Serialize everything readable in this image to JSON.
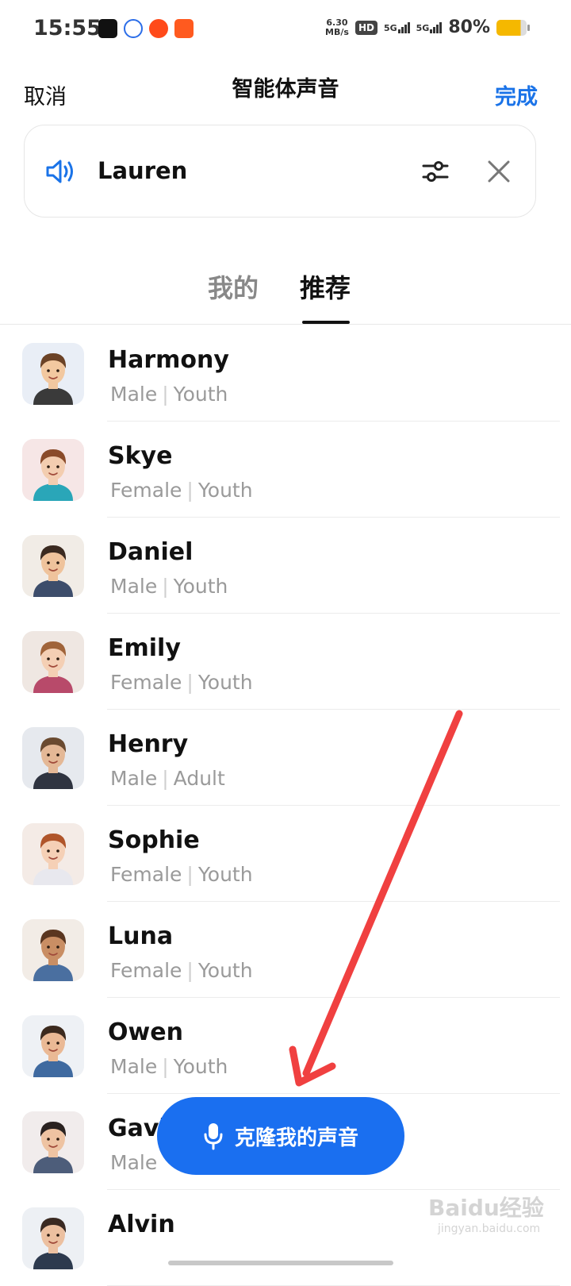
{
  "status_bar": {
    "time": "15:55",
    "net_speed_value": "6.30",
    "net_speed_unit": "MB/s",
    "hd_label": "HD",
    "sim1_label": "5G",
    "sim2_label": "5G",
    "battery_percent": "80%",
    "battery_color": "#f5b800",
    "app_icons": [
      "tiktok-icon",
      "baidu-paw-icon",
      "taobao-icon",
      "xiaohongshu-icon"
    ]
  },
  "header": {
    "cancel_label": "取消",
    "title": "智能体声音",
    "done_label": "完成",
    "accent_color": "#1a73e8"
  },
  "selected_voice": {
    "name": "Lauren",
    "icons": [
      "speaker-icon",
      "settings-sliders-icon",
      "close-icon"
    ]
  },
  "tabs": {
    "mine_label": "我的",
    "recommended_label": "推荐",
    "active": "推荐"
  },
  "voices": [
    {
      "name": "Harmony",
      "gender": "Male",
      "age": "Youth",
      "avatar": "avatar-harmony"
    },
    {
      "name": "Skye",
      "gender": "Female",
      "age": "Youth",
      "avatar": "avatar-skye"
    },
    {
      "name": "Daniel",
      "gender": "Male",
      "age": "Youth",
      "avatar": "avatar-daniel"
    },
    {
      "name": "Emily",
      "gender": "Female",
      "age": "Youth",
      "avatar": "avatar-emily"
    },
    {
      "name": "Henry",
      "gender": "Male",
      "age": "Adult",
      "avatar": "avatar-henry"
    },
    {
      "name": "Sophie",
      "gender": "Female",
      "age": "Youth",
      "avatar": "avatar-sophie"
    },
    {
      "name": "Luna",
      "gender": "Female",
      "age": "Youth",
      "avatar": "avatar-luna"
    },
    {
      "name": "Owen",
      "gender": "Male",
      "age": "Youth",
      "avatar": "avatar-owen"
    },
    {
      "name": "Gavi",
      "gender": "Male",
      "age": "",
      "avatar": "avatar-gavin"
    },
    {
      "name": "Alvin",
      "gender": "",
      "age": "",
      "avatar": "avatar-alvin"
    }
  ],
  "tag_separator": "|",
  "clone_button": {
    "label": "克隆我的声音",
    "icon": "microphone-icon",
    "color": "#1a6ff0"
  },
  "annotation": {
    "type": "arrow",
    "color": "#f04040"
  },
  "watermark": {
    "text": "Baidu经验",
    "sub": "jingyan.baidu.com"
  }
}
